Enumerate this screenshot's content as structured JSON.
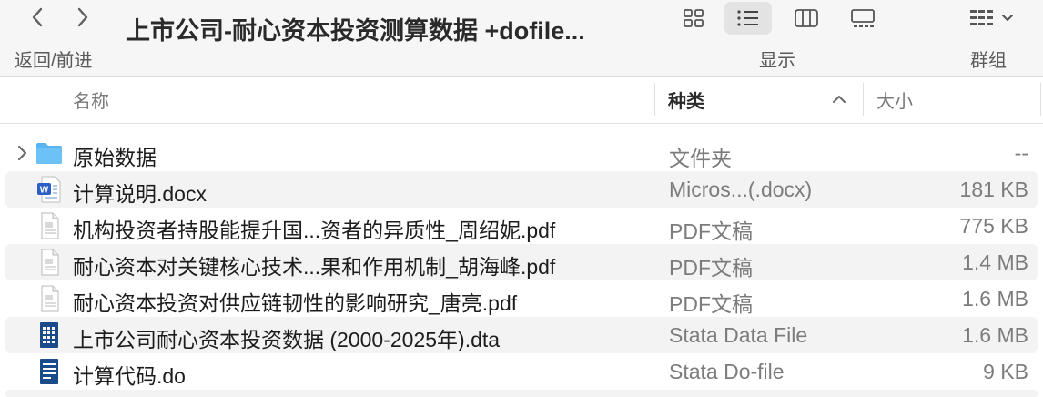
{
  "toolbar": {
    "title": "上市公司-耐心资本投资测算数据 +dofile...",
    "nav_label": "返回/前进",
    "view_label": "显示",
    "group_label": "群组"
  },
  "columns": {
    "name": "名称",
    "kind": "种类",
    "size": "大小"
  },
  "files": [
    {
      "name": "原始数据",
      "kind": "文件夹",
      "size": "--",
      "icon": "folder-icon"
    },
    {
      "name": "计算说明.docx",
      "kind": "Micros...(.docx)",
      "size": "181 KB",
      "icon": "word-document-icon"
    },
    {
      "name": "机构投资者持股能提升国...资者的异质性_周绍妮.pdf",
      "kind": "PDF文稿",
      "size": "775 KB",
      "icon": "pdf-document-icon"
    },
    {
      "name": "耐心资本对关键核心技术...果和作用机制_胡海峰.pdf",
      "kind": "PDF文稿",
      "size": "1.4 MB",
      "icon": "pdf-document-icon"
    },
    {
      "name": "耐心资本投资对供应链韧性的影响研究_唐亮.pdf",
      "kind": "PDF文稿",
      "size": "1.6 MB",
      "icon": "pdf-document-icon"
    },
    {
      "name": "上市公司耐心资本投资数据 (2000-2025年).dta",
      "kind": "Stata Data File",
      "size": "1.6 MB",
      "icon": "stata-data-icon"
    },
    {
      "name": "计算代码.do",
      "kind": "Stata Do-file",
      "size": "9 KB",
      "icon": "stata-dofile-icon"
    }
  ],
  "colors": {
    "folder": "#5ab4f0",
    "word": "#2b5fc7",
    "stata": "#1a4c8c",
    "alt_row": "#f3f3f3"
  }
}
